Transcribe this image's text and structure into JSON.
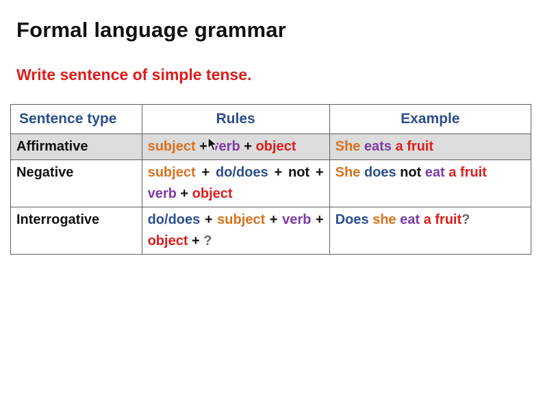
{
  "page": {
    "title": "Formal language grammar",
    "subtitle": "Write sentence of simple tense."
  },
  "colors": {
    "title": "#111111",
    "subtitle": "#e01b1b",
    "header": "#2b4e8c",
    "subject": "#d9711c",
    "verb": "#7d3aa6",
    "object": "#e01b1b",
    "aux": "#2b4e8c",
    "plain": "#111111",
    "question": "#666666",
    "row_highlight": "#dcdcdc"
  },
  "table": {
    "headers": [
      "Sentence type",
      "Rules",
      "Example"
    ],
    "rows": [
      {
        "type": "Affirmative",
        "highlight": true,
        "rules": [
          {
            "t": "subject",
            "c": "subject"
          },
          {
            "t": " + ",
            "c": "plain"
          },
          {
            "t": "verb",
            "c": "verb"
          },
          {
            "t": " + ",
            "c": "plain"
          },
          {
            "t": "object",
            "c": "object"
          }
        ],
        "example": [
          {
            "t": "She ",
            "c": "subject"
          },
          {
            "t": "eats ",
            "c": "verb"
          },
          {
            "t": "a fruit",
            "c": "object"
          }
        ]
      },
      {
        "type": "Negative",
        "highlight": false,
        "rules": [
          {
            "t": "subject",
            "c": "subject"
          },
          {
            "t": " + ",
            "c": "plain"
          },
          {
            "t": "do/does",
            "c": "aux"
          },
          {
            "t": " + ",
            "c": "plain"
          },
          {
            "t": "not",
            "c": "plain"
          },
          {
            "t": " + ",
            "c": "plain"
          },
          {
            "t": "verb",
            "c": "verb"
          },
          {
            "t": " + ",
            "c": "plain"
          },
          {
            "t": "object",
            "c": "object"
          }
        ],
        "example": [
          {
            "t": "She ",
            "c": "subject"
          },
          {
            "t": "does ",
            "c": "aux"
          },
          {
            "t": "not ",
            "c": "plain"
          },
          {
            "t": "eat ",
            "c": "verb"
          },
          {
            "t": "a fruit",
            "c": "object"
          }
        ]
      },
      {
        "type": "Interrogative",
        "highlight": false,
        "rules": [
          {
            "t": "do/does",
            "c": "aux"
          },
          {
            "t": " + ",
            "c": "plain"
          },
          {
            "t": "subject",
            "c": "subject"
          },
          {
            "t": " + ",
            "c": "plain"
          },
          {
            "t": "verb",
            "c": "verb"
          },
          {
            "t": " + ",
            "c": "plain"
          },
          {
            "t": "object",
            "c": "object"
          },
          {
            "t": " + ",
            "c": "plain"
          },
          {
            "t": "?",
            "c": "question"
          }
        ],
        "example": [
          {
            "t": "Does ",
            "c": "aux"
          },
          {
            "t": "she ",
            "c": "subject"
          },
          {
            "t": "eat ",
            "c": "verb"
          },
          {
            "t": "a fruit",
            "c": "object"
          },
          {
            "t": "?",
            "c": "question"
          }
        ]
      }
    ]
  },
  "cursor": {
    "icon": "mouse-pointer-icon"
  }
}
